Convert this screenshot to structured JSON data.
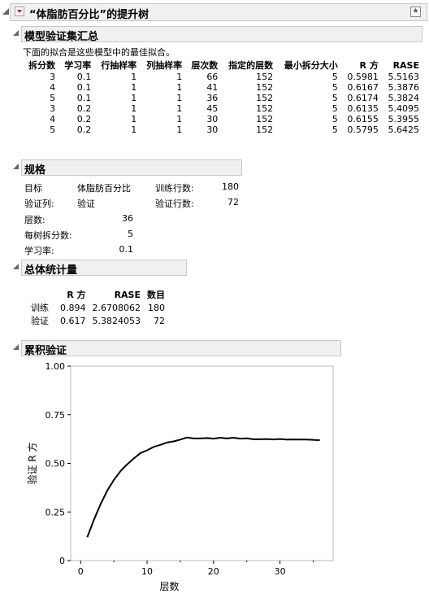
{
  "report": {
    "title": "“体脂肪百分比”的提升树"
  },
  "summary": {
    "header": "模型验证集汇总",
    "note": "下面的拟合是这些模型中的最佳拟合。",
    "columns": [
      "拆分数",
      "学习率",
      "行抽样率",
      "列抽样率",
      "层次数",
      "指定的层数",
      "最小拆分大小",
      "R 方",
      "RASE"
    ],
    "rows": [
      [
        "3",
        "0.1",
        "1",
        "1",
        "66",
        "152",
        "5",
        "0.5981",
        "5.5163"
      ],
      [
        "4",
        "0.1",
        "1",
        "1",
        "41",
        "152",
        "5",
        "0.6167",
        "5.3876"
      ],
      [
        "5",
        "0.1",
        "1",
        "1",
        "36",
        "152",
        "5",
        "0.6174",
        "5.3824"
      ],
      [
        "3",
        "0.2",
        "1",
        "1",
        "45",
        "152",
        "5",
        "0.6135",
        "5.4095"
      ],
      [
        "4",
        "0.2",
        "1",
        "1",
        "30",
        "152",
        "5",
        "0.6155",
        "5.3955"
      ],
      [
        "5",
        "0.2",
        "1",
        "1",
        "30",
        "152",
        "5",
        "0.5795",
        "5.6425"
      ]
    ]
  },
  "spec": {
    "header": "规格",
    "target_label": "目标",
    "target_value": "体脂肪百分比",
    "train_rows_label": "训练行数:",
    "train_rows_value": "180",
    "valid_col_label": "验证列:",
    "valid_col_value": "验证",
    "valid_rows_label": "验证行数:",
    "valid_rows_value": "72",
    "layers_label": "层数:",
    "layers_value": "36",
    "splits_label": "每树拆分数:",
    "splits_value": "5",
    "lr_label": "学习率:",
    "lr_value": "0.1"
  },
  "stats": {
    "header": "总体统计量",
    "columns": [
      "",
      "R 方",
      "RASE",
      "数目"
    ],
    "rows": [
      [
        "训练",
        "0.894",
        "2.6708062",
        "180"
      ],
      [
        "验证",
        "0.617",
        "5.3824053",
        "72"
      ]
    ]
  },
  "cumulative": {
    "header": "累积验证"
  },
  "chart_data": {
    "type": "line",
    "xlabel": "层数",
    "ylabel": "验证 R 方",
    "xlim": [
      -1.5,
      38
    ],
    "ylim": [
      0,
      1
    ],
    "xticks": [
      "0",
      "10",
      "20",
      "30"
    ],
    "yticks": [
      "0",
      "0.25",
      "0.50",
      "0.75",
      "1.00"
    ],
    "x": [
      1,
      2,
      3,
      4,
      5,
      6,
      7,
      8,
      9,
      10,
      11,
      12,
      13,
      14,
      15,
      16,
      17,
      18,
      19,
      20,
      21,
      22,
      23,
      24,
      25,
      26,
      27,
      28,
      29,
      30,
      31,
      32,
      33,
      34,
      35,
      36
    ],
    "values": [
      0.12,
      0.21,
      0.29,
      0.36,
      0.415,
      0.46,
      0.495,
      0.525,
      0.553,
      0.567,
      0.585,
      0.595,
      0.607,
      0.613,
      0.622,
      0.633,
      0.628,
      0.628,
      0.63,
      0.627,
      0.632,
      0.628,
      0.632,
      0.627,
      0.629,
      0.624,
      0.624,
      0.625,
      0.623,
      0.625,
      0.622,
      0.623,
      0.622,
      0.622,
      0.621,
      0.619
    ],
    "color": "#000000"
  }
}
